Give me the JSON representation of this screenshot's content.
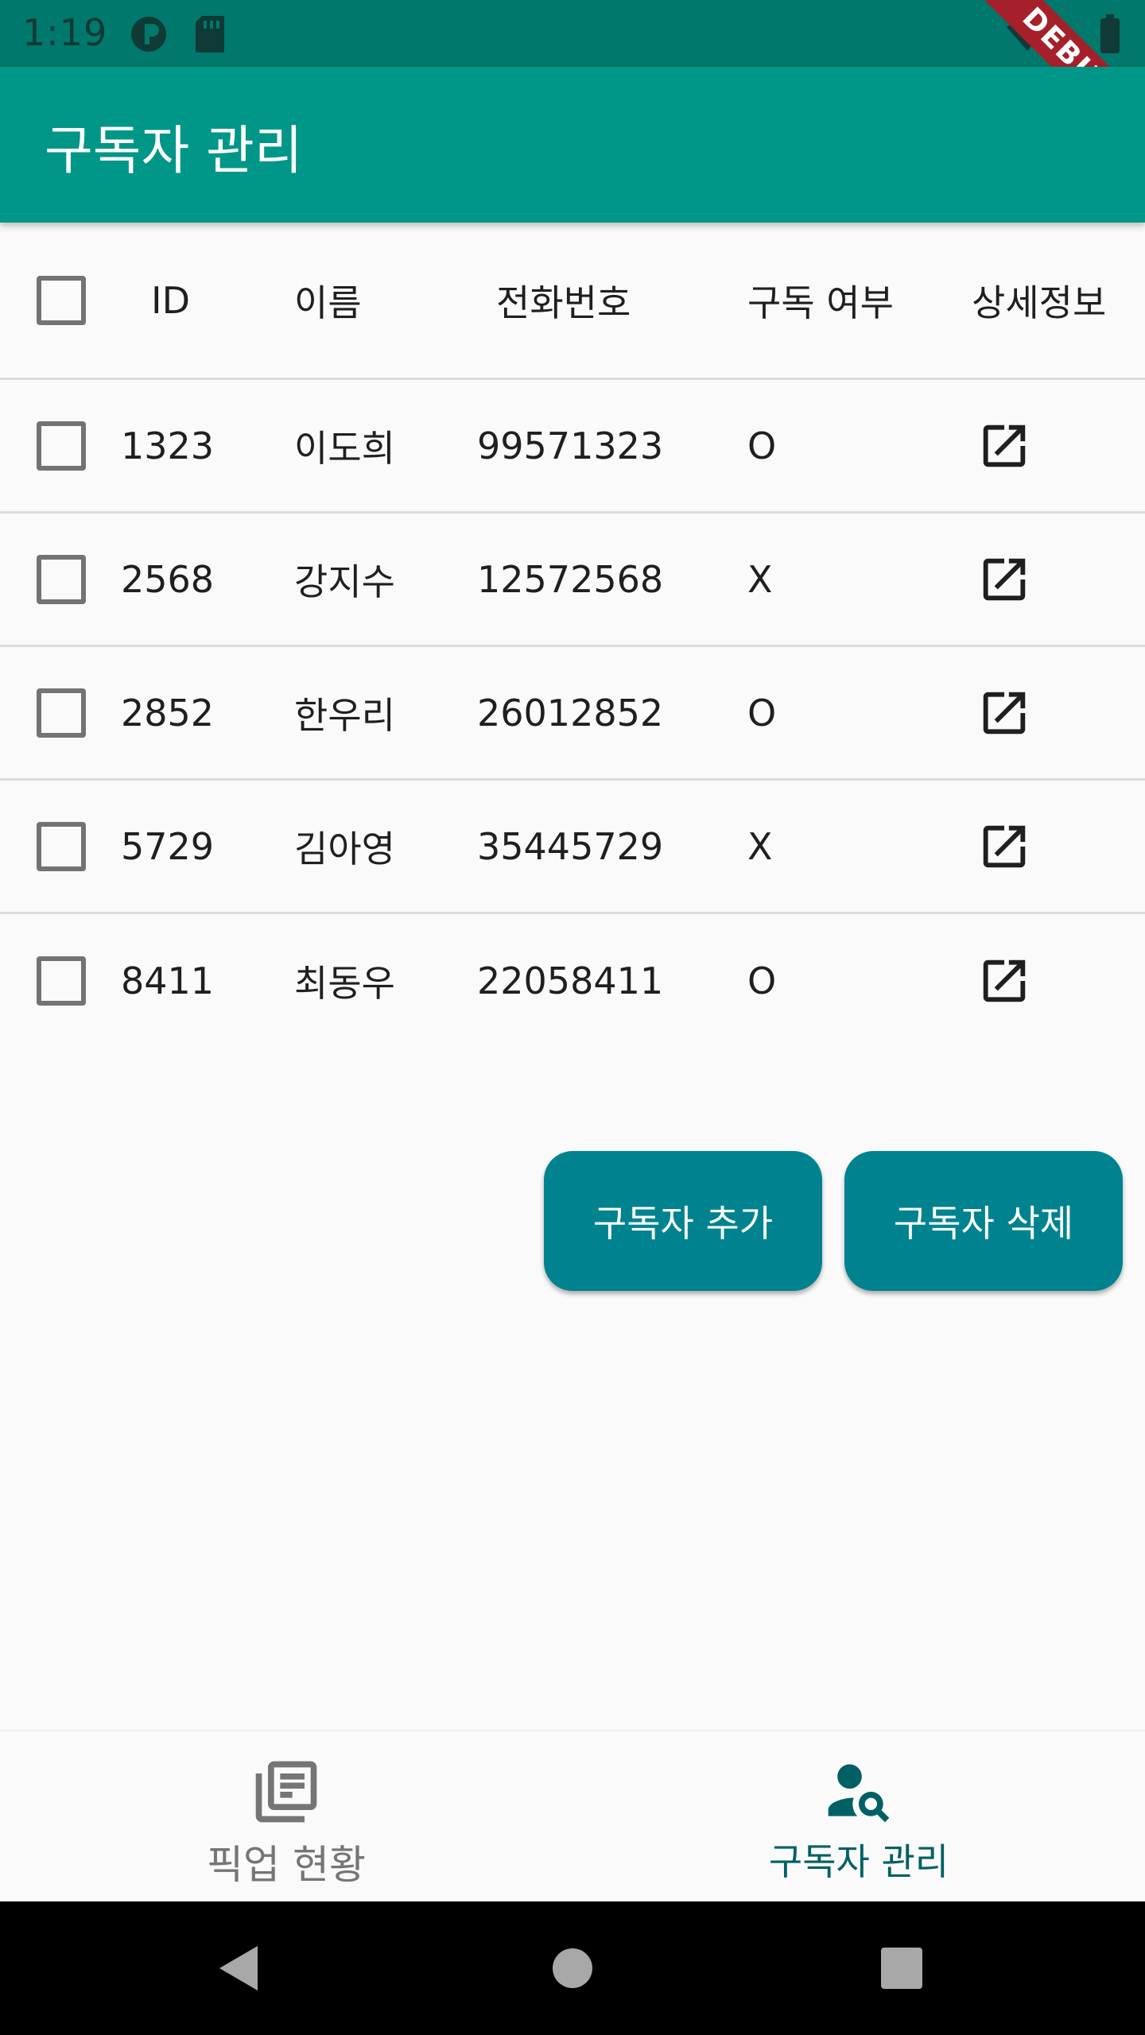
{
  "status_bar": {
    "time": "1:19",
    "debug_label": "DEBUG"
  },
  "app_bar": {
    "title": "구독자 관리"
  },
  "table": {
    "headers": {
      "id": "ID",
      "name": "이름",
      "phone": "전화번호",
      "subscribed": "구독 여부",
      "detail": "상세정보"
    },
    "rows": [
      {
        "id": "1323",
        "name": "이도희",
        "phone": "99571323",
        "subscribed": "O"
      },
      {
        "id": "2568",
        "name": "강지수",
        "phone": "12572568",
        "subscribed": "X"
      },
      {
        "id": "2852",
        "name": "한우리",
        "phone": "26012852",
        "subscribed": "O"
      },
      {
        "id": "5729",
        "name": "김아영",
        "phone": "35445729",
        "subscribed": "X"
      },
      {
        "id": "8411",
        "name": "최동우",
        "phone": "22058411",
        "subscribed": "O"
      }
    ]
  },
  "actions": {
    "add_label": "구독자 추가",
    "delete_label": "구독자 삭제"
  },
  "bottom_nav": {
    "items": [
      {
        "label": "픽업 현황",
        "icon": "news-list-icon",
        "active": false
      },
      {
        "label": "구독자 관리",
        "icon": "person-search-icon",
        "active": true
      }
    ]
  },
  "colors": {
    "status_bar": "#00786b",
    "app_bar": "#009688",
    "button": "#00838f",
    "active_nav": "#006064",
    "inactive_nav": "#757575",
    "debug_ribbon": "#a5202a"
  }
}
